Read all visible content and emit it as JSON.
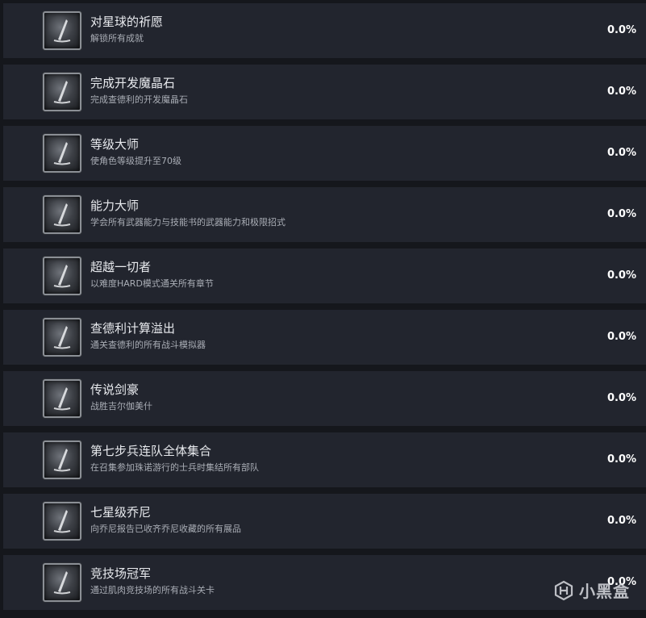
{
  "achievements": [
    {
      "title": "对星球的祈愿",
      "description": "解锁所有成就",
      "percent": "0.0%"
    },
    {
      "title": "完成开发魔晶石",
      "description": "完成查德利的开发魔晶石",
      "percent": "0.0%"
    },
    {
      "title": "等级大师",
      "description": "使角色等级提升至70级",
      "percent": "0.0%"
    },
    {
      "title": "能力大师",
      "description": "学会所有武器能力与技能书的武器能力和极限招式",
      "percent": "0.0%"
    },
    {
      "title": "超越一切者",
      "description": "以难度HARD模式通关所有章节",
      "percent": "0.0%"
    },
    {
      "title": "查德利计算溢出",
      "description": "通关查德利的所有战斗模拟器",
      "percent": "0.0%"
    },
    {
      "title": "传说剑豪",
      "description": "战胜吉尔伽美什",
      "percent": "0.0%"
    },
    {
      "title": "第七步兵连队全体集合",
      "description": "在召集参加珠诺游行的士兵时集结所有部队",
      "percent": "0.0%"
    },
    {
      "title": "七星级乔尼",
      "description": "向乔尼报告已收齐乔尼收藏的所有展品",
      "percent": "0.0%"
    },
    {
      "title": "竞技场冠军",
      "description": "通过肌肉竞技场的所有战斗关卡",
      "percent": "0.0%"
    }
  ],
  "icon": "achievement-locked-icon",
  "watermark": {
    "text": "小黑盒",
    "icon": "heybox-logo-icon"
  },
  "colors": {
    "row_bg": "#22252e",
    "page_bg": "#15171c",
    "title": "#e8eaee",
    "desc": "#a9adb5"
  }
}
